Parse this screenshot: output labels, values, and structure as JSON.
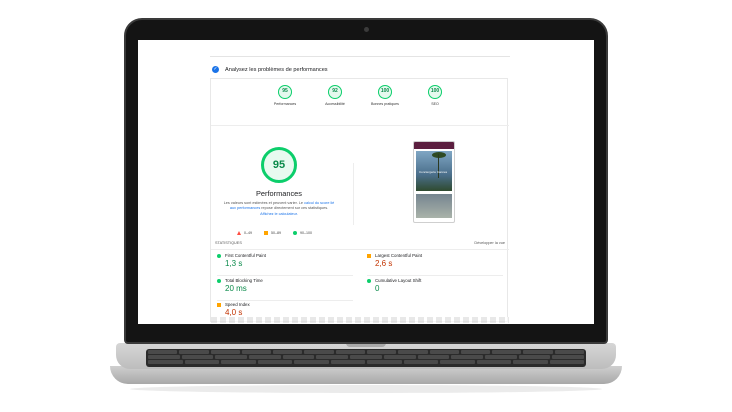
{
  "header": {
    "analyse_text": "Analysez les problèmes de performances"
  },
  "gauges": [
    {
      "score": "95",
      "label": "Performances"
    },
    {
      "score": "92",
      "label": "Accessibilité"
    },
    {
      "score": "100",
      "label": "Bonnes pratiques"
    },
    {
      "score": "100",
      "label": "SEO"
    }
  ],
  "performance": {
    "score": "95",
    "title": "Performances",
    "desc_part1": "Les valeurs sont estimées et peuvent varier. Le ",
    "desc_link1": "calcul du score lié aux performances",
    "desc_part2": " repose directement sur ces statistiques. ",
    "desc_link2": "Affichez le calculateur.",
    "legend": [
      {
        "label": "0–49"
      },
      {
        "label": "50–89"
      },
      {
        "label": "90–100"
      }
    ]
  },
  "screenshot": {
    "caption": "Conciergerie Cannes"
  },
  "stats": {
    "heading": "STATISTIQUES",
    "expand_label": "Développer la vue",
    "metrics": [
      {
        "name": "First Contentful Paint",
        "value": "1,3 s",
        "status": "good"
      },
      {
        "name": "Largest Contentful Paint",
        "value": "2,6 s",
        "status": "average"
      },
      {
        "name": "Total Blocking Time",
        "value": "20 ms",
        "status": "good"
      },
      {
        "name": "Cumulative Layout Shift",
        "value": "0",
        "status": "good"
      },
      {
        "name": "Speed Index",
        "value": "4,0 s",
        "status": "average"
      }
    ]
  },
  "colors": {
    "good": "#0cce6b",
    "average": "#ffa400",
    "poor": "#ff4e42",
    "link": "#1a73e8"
  }
}
